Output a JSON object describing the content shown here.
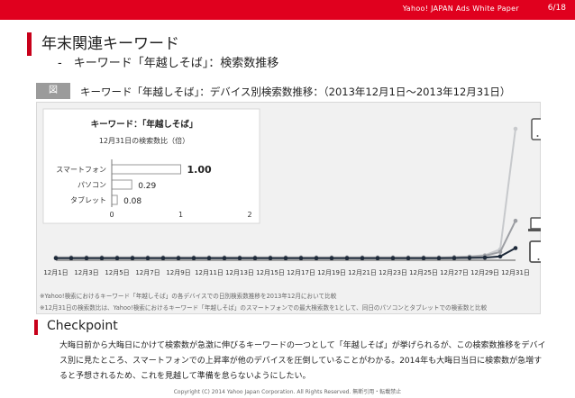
{
  "header": {
    "text": "Yahoo! JAPAN Ads White Paper",
    "page": "6/18"
  },
  "page_title": "年末関連キーワード",
  "subtitle": "-　キーワード「年越しそば」：検索数推移",
  "figure": {
    "tag": "図",
    "caption": "キーワード「年越しそば」：デバイス別検索数推移：（2013年12月1日〜2013年12月31日）"
  },
  "notes": [
    "※Yahoo!検索におけるキーワード「年越しそば」の各デバイスでの日別検索数推移を2013年12月において比較",
    "※12月31日の検索数比は、Yahoo!検索におけるキーワード「年越しそば」のスマートフォンでの最大検索数を1として、同日のパソコンとタブレットでの検索数と比較"
  ],
  "checkpoint": {
    "title": "Checkpoint",
    "body": "大晦日前から大晦日にかけて検索数が急激に伸びるキーワードの一つとして「年越しそば」が挙げられるが、この検索数推移をデバイス別に見たところ、スマートフォンでの上昇率が他のデバイスを圧倒していることがわかる。2014年も大晦日当日に検索数が急増すると予想されるため、これを見越して準備を怠らないようにしたい。"
  },
  "copyright": "Copyright (C) 2014 Yahoo Japan Corporation. All Rights Reserved. 無断引用・転載禁止",
  "colors": {
    "accent": "#e0001e",
    "line_dark": "#1e2a3a",
    "line_gray": "#9c9ea3",
    "line_light": "#c7c9cc",
    "bar": "#ffffff"
  },
  "icons": [
    "smartphone-icon",
    "laptop-icon",
    "tablet-icon"
  ],
  "chart_data": [
    {
      "type": "line",
      "x": [
        "12月1日",
        "12月2日",
        "12月3日",
        "12月4日",
        "12月5日",
        "12月6日",
        "12月7日",
        "12月8日",
        "12月9日",
        "12月10日",
        "12月11日",
        "12月12日",
        "12月13日",
        "12月14日",
        "12月15日",
        "12月16日",
        "12月17日",
        "12月18日",
        "12月19日",
        "12月20日",
        "12月21日",
        "12月22日",
        "12月23日",
        "12月24日",
        "12月25日",
        "12月26日",
        "12月27日",
        "12月28日",
        "12月29日",
        "12月30日",
        "12月31日"
      ],
      "tick_labels": [
        "12月1日",
        "12月3日",
        "12月5日",
        "12月7日",
        "12月9日",
        "12月11日",
        "12月13日",
        "12月15日",
        "12月17日",
        "12月19日",
        "12月21日",
        "12月23日",
        "12月25日",
        "12月27日",
        "12月29日",
        "12月31日"
      ],
      "series": [
        {
          "device": "smartphone",
          "color": "#c7c9cc",
          "values": [
            0.01,
            0.01,
            0.01,
            0.01,
            0.01,
            0.01,
            0.01,
            0.01,
            0.01,
            0.01,
            0.01,
            0.01,
            0.01,
            0.01,
            0.01,
            0.01,
            0.01,
            0.01,
            0.01,
            0.01,
            0.01,
            0.01,
            0.01,
            0.01,
            0.01,
            0.01,
            0.01,
            0.015,
            0.025,
            0.07,
            1.0
          ]
        },
        {
          "device": "pc",
          "color": "#9c9ea3",
          "values": [
            0.005,
            0.005,
            0.005,
            0.005,
            0.005,
            0.005,
            0.005,
            0.005,
            0.005,
            0.005,
            0.005,
            0.005,
            0.005,
            0.005,
            0.005,
            0.005,
            0.005,
            0.005,
            0.005,
            0.005,
            0.005,
            0.005,
            0.005,
            0.005,
            0.005,
            0.005,
            0.01,
            0.012,
            0.02,
            0.05,
            0.29
          ]
        },
        {
          "device": "tablet",
          "color": "#1e2a3a",
          "values": [
            0.002,
            0.002,
            0.002,
            0.002,
            0.002,
            0.002,
            0.002,
            0.002,
            0.002,
            0.002,
            0.002,
            0.002,
            0.002,
            0.002,
            0.002,
            0.002,
            0.002,
            0.002,
            0.002,
            0.002,
            0.002,
            0.002,
            0.002,
            0.002,
            0.002,
            0.002,
            0.003,
            0.004,
            0.006,
            0.015,
            0.08
          ]
        }
      ],
      "ylim": [
        0,
        1.0
      ],
      "grid": false
    },
    {
      "type": "bar",
      "orientation": "horizontal",
      "title": "キーワード：「年越しそば」",
      "subtitle": "12月31日の検索数比（倍）",
      "categories": [
        "スマートフォン",
        "パソコン",
        "タブレット"
      ],
      "values": [
        1.0,
        0.29,
        0.08
      ],
      "data_labels": [
        "1.00",
        "0.29",
        "0.08"
      ],
      "xticks": [
        "0",
        "1",
        "2"
      ],
      "xlim": [
        0,
        2
      ]
    }
  ]
}
